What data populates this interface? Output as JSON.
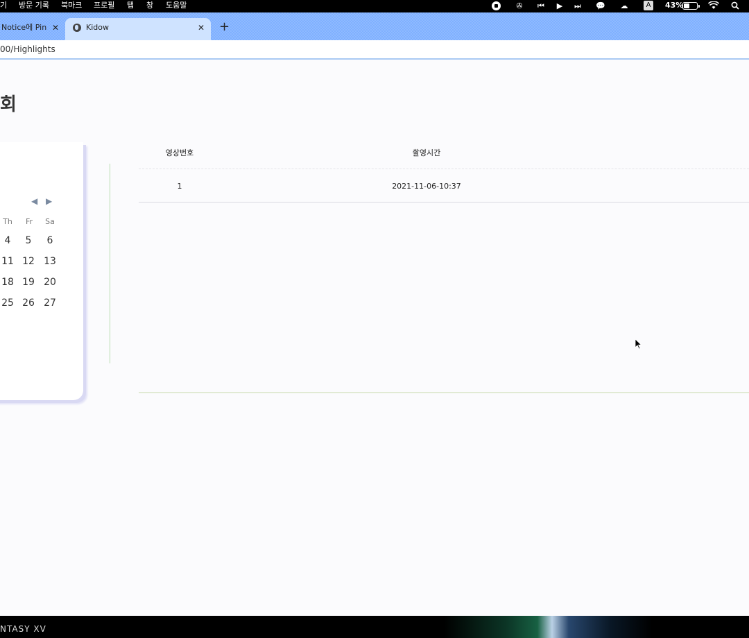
{
  "menubar": {
    "items": [
      "기",
      "방문 기록",
      "북마크",
      "프로필",
      "탭",
      "창",
      "도움말"
    ],
    "battery_percent": "43%",
    "battery_level": 0.43,
    "input_indicator": "A",
    "icons": [
      "stop-record-icon",
      "sync-icon",
      "previous-track-icon",
      "play-icon",
      "next-track-icon",
      "chat-icon",
      "creative-cloud-icon",
      "battery-icon",
      "wifi-icon",
      "search-icon"
    ]
  },
  "tabs": [
    {
      "label": "Notice에 Pin"
    },
    {
      "label": "Kidow",
      "active": true
    }
  ],
  "address": {
    "url": "00/Highlights"
  },
  "page": {
    "title": "회"
  },
  "calendar": {
    "weekdays": [
      "Th",
      "Fr",
      "Sa"
    ],
    "weeks": [
      [
        "4",
        "5",
        "6"
      ],
      [
        "11",
        "12",
        "13"
      ],
      [
        "18",
        "19",
        "20"
      ],
      [
        "25",
        "26",
        "27"
      ]
    ]
  },
  "table": {
    "headers": [
      "영상번호",
      "촬영시간"
    ],
    "rows": [
      {
        "num": "1",
        "time": "2021-11-06-10:37"
      }
    ]
  },
  "taskbar": {
    "text": "NTASY XV"
  }
}
